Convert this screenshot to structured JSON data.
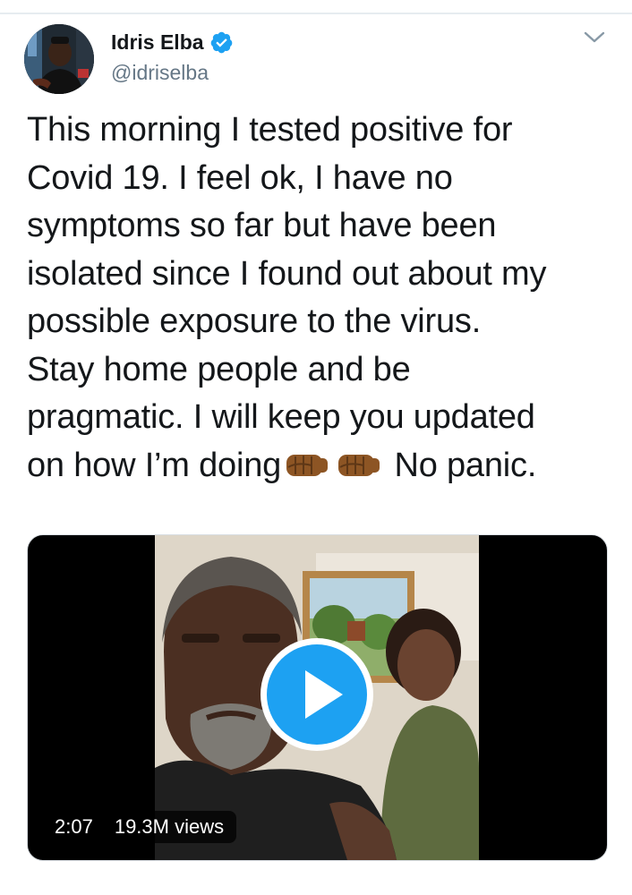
{
  "tweet": {
    "author": {
      "display_name": "Idris Elba",
      "handle": "@idriselba",
      "verified": true
    },
    "text_lines": [
      "This morning I tested positive for",
      "Covid 19. I feel ok, I have no",
      "symptoms so far but have been",
      "isolated since I found out about my",
      "possible exposure to the virus.",
      "Stay home people and be",
      "pragmatic. I will keep you updated",
      "on how I’m doing",
      "No panic."
    ],
    "emoji": [
      "oncoming-fist-medium-dark",
      "oncoming-fist-medium-dark"
    ],
    "video": {
      "duration": "2:07",
      "views": "19.3M views"
    }
  },
  "icons": {
    "verified": "verified-badge-icon",
    "menu": "chevron-down-icon",
    "play": "play-icon"
  },
  "colors": {
    "accent": "#1da1f2",
    "text": "#14171a",
    "secondary_text": "#657786",
    "divider": "#e6ecf0",
    "fist": "#8d5524"
  }
}
